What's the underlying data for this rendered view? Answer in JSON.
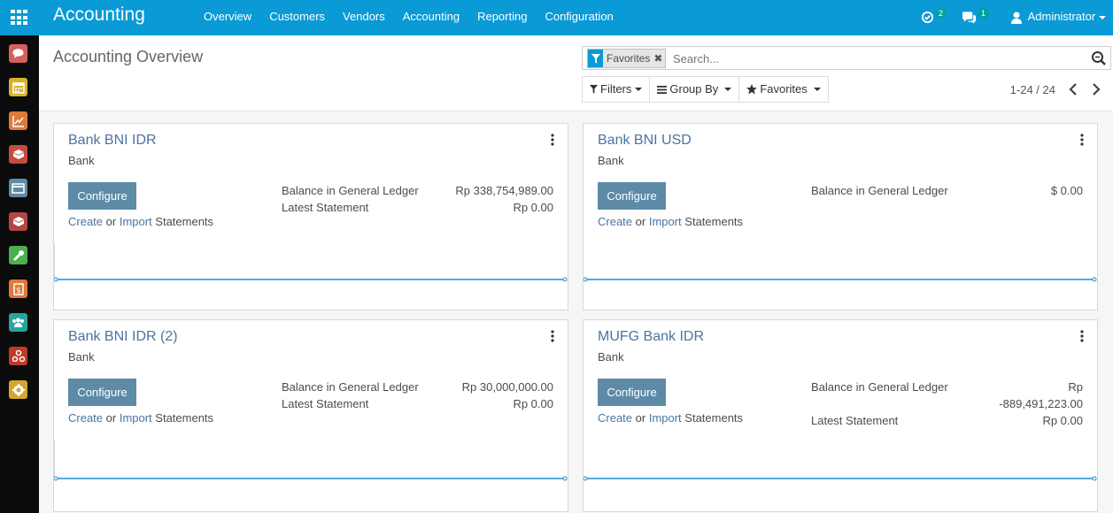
{
  "app": {
    "title": "Accounting",
    "menu": [
      "Overview",
      "Customers",
      "Vendors",
      "Accounting",
      "Reporting",
      "Configuration"
    ]
  },
  "systray": {
    "activity_count": "2",
    "messages_count": "1",
    "user": "Administrator"
  },
  "sidebar": {
    "icons": [
      {
        "name": "discuss-icon",
        "color": "#d65f5f"
      },
      {
        "name": "calendar-icon",
        "color": "#d7b32a"
      },
      {
        "name": "reporting-icon",
        "color": "#e07a3c"
      },
      {
        "name": "inventory-icon",
        "color": "#c54c3e"
      },
      {
        "name": "invoicing-icon",
        "color": "#5d8ba7"
      },
      {
        "name": "purchase-icon",
        "color": "#b54545"
      },
      {
        "name": "settings-tools-icon",
        "color": "#4caf50"
      },
      {
        "name": "accounting-icon",
        "color": "#e0773a"
      },
      {
        "name": "employees-icon",
        "color": "#27a4a0"
      },
      {
        "name": "apps-share-icon",
        "color": "#c0392b"
      },
      {
        "name": "settings-icon",
        "color": "#d4a72c"
      }
    ]
  },
  "control": {
    "breadcrumb": "Accounting Overview",
    "facet_label": "Favorites",
    "search_placeholder": "Search...",
    "filters_label": "Filters",
    "groupby_label": "Group By",
    "favorites_label": "Favorites",
    "pager": "1-24 / 24"
  },
  "accent_color": "#0a9ad6",
  "configure_color": "#5d8ba7",
  "link_color": "#4c73a2",
  "cards": [
    {
      "title": "Bank BNI IDR",
      "subtitle": "Bank",
      "configure": "Configure",
      "create": "Create",
      "or": " or ",
      "import": "Import",
      "statements": " Statements",
      "balance_label": "Balance in General Ledger",
      "balance_value": "Rp 338,754,989.00",
      "latest_label": "Latest Statement",
      "latest_value": "Rp 0.00"
    },
    {
      "title": "Bank BNI USD",
      "subtitle": "Bank",
      "configure": "Configure",
      "create": "Create",
      "or": " or ",
      "import": "Import",
      "statements": " Statements",
      "balance_label": "Balance in General Ledger",
      "balance_value": "$ 0.00"
    },
    {
      "title": "Bank BNI IDR (2)",
      "subtitle": "Bank",
      "configure": "Configure",
      "create": "Create",
      "or": " or ",
      "import": "Import",
      "statements": " Statements",
      "balance_label": "Balance in General Ledger",
      "balance_value": "Rp 30,000,000.00",
      "latest_label": "Latest Statement",
      "latest_value": "Rp 0.00"
    },
    {
      "title": "MUFG Bank IDR",
      "subtitle": "Bank",
      "configure": "Configure",
      "create": "Create",
      "or": " or ",
      "import": "Import",
      "statements": " Statements",
      "balance_label": "Balance in General Ledger",
      "balance_value_line1": "Rp",
      "balance_value_line2": "-889,491,223.00",
      "latest_label": "Latest Statement",
      "latest_value": "Rp 0.00"
    }
  ]
}
